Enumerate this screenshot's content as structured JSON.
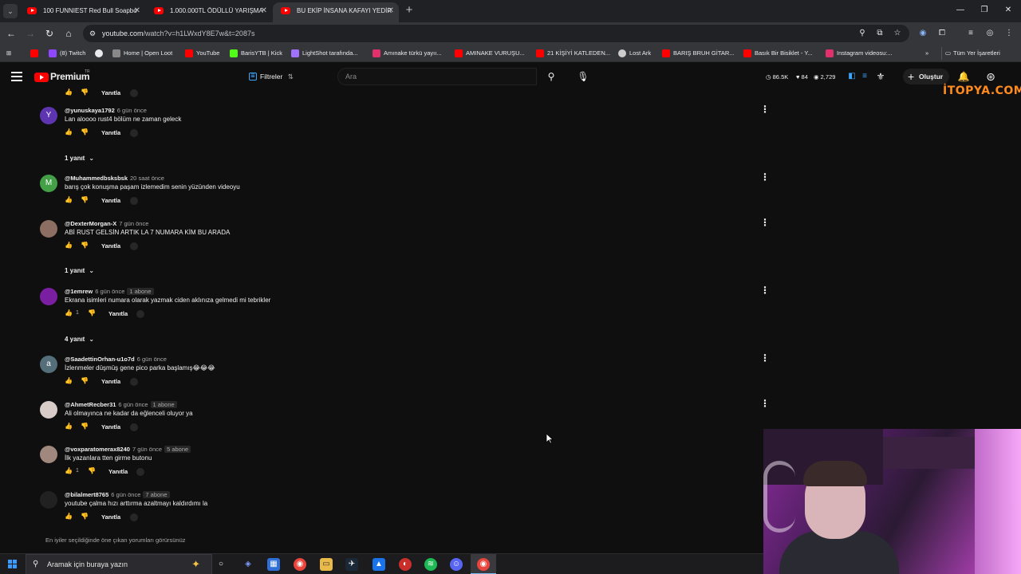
{
  "browser": {
    "tabs": [
      {
        "title": "100 FUNNIEST Red Bull Soapbo"
      },
      {
        "title": "1.000.000TL ÖDÜLLÜ YARIŞMA"
      },
      {
        "title": "BU EKİP İNSANA KAFAYI YEDİR"
      }
    ],
    "url_host": "youtube.com",
    "url_path": "/watch?v=h1LWxdY8E7w&t=2087s",
    "bookmarks": [
      {
        "label": "",
        "color": "#ff0000"
      },
      {
        "label": "(8) Twitch",
        "color": "#9146ff"
      },
      {
        "label": "",
        "color": "#e8eaed"
      },
      {
        "label": "Home | Open Loot",
        "color": "#888888"
      },
      {
        "label": "YouTube",
        "color": "#ff0000"
      },
      {
        "label": "BarisYTB | Kick",
        "color": "#53fc18"
      },
      {
        "label": "LightShot tarafında...",
        "color": "#a070ff"
      },
      {
        "label": "Amınake türkü yayıı...",
        "color": "#e1306c"
      },
      {
        "label": "AMINAKE VURUŞU...",
        "color": "#ff0000"
      },
      {
        "label": "21 KİŞİYİ KATLEDEN...",
        "color": "#ff0000"
      },
      {
        "label": "Lost Ark",
        "color": "#cccccc"
      },
      {
        "label": "BARIŞ BRUH GİTAR...",
        "color": "#ff0000"
      },
      {
        "label": "Basık Bir Bisiklet - Y...",
        "color": "#ff0000"
      },
      {
        "label": "Instagram videosu:...",
        "color": "#e1306c"
      }
    ],
    "bookmarks_overflow": "»",
    "all_bookmarks": "Tüm Yer İşaretleri"
  },
  "youtube": {
    "brand": "Premium",
    "brand_region": "TR",
    "filters_label": "Filtreler",
    "search_placeholder": "Ara",
    "stats": [
      {
        "icon": "◷",
        "value": "86.5K"
      },
      {
        "icon": "♥",
        "value": "84"
      },
      {
        "icon": "◉",
        "value": "2,729"
      }
    ],
    "create_label": "Oluştur",
    "overlay_logo": "İTOPYA.COM"
  },
  "comments": [
    {
      "author": "@yunuskaya1792",
      "time": "6 gün önce",
      "badge": "",
      "text": "Lan aloooo rust4  bölüm ne zaman geleck",
      "likes": "",
      "reply_label": "Yanıtla",
      "replies": "1 yanıt",
      "avatar_letter": "Y",
      "avatar_color": "#5e35b1"
    },
    {
      "author": "@Muhammedbsksbsk",
      "time": "20 saat önce",
      "badge": "",
      "text": "barış çok konuşma paşam izlemedim senin yüzünden videoyu",
      "likes": "",
      "reply_label": "Yanıtla",
      "replies": "",
      "avatar_letter": "M",
      "avatar_color": "#43a047"
    },
    {
      "author": "@DexterMorgan-X",
      "time": "7 gün önce",
      "badge": "",
      "text": "ABİ RUST GELSİN ARTIK LA 7 NUMARA KİM BU ARADA",
      "likes": "",
      "reply_label": "Yanıtla",
      "replies": "1 yanıt",
      "avatar_letter": "",
      "avatar_color": "#8d6e63"
    },
    {
      "author": "@1emrew",
      "time": "6 gün önce",
      "badge": "1 abone",
      "text": "Ekrana isimleri numara olarak yazmak ciden aklınıza gelmedi mi tebrikler",
      "likes": "1",
      "reply_label": "Yanıtla",
      "replies": "4 yanıt",
      "avatar_letter": "",
      "avatar_color": "#7b1fa2"
    },
    {
      "author": "@SaadettinOrhan-u1o7d",
      "time": "6 gün önce",
      "badge": "",
      "text": "İzlenmeler düşmüş gene pico parka başlamış😂😂😂",
      "likes": "",
      "reply_label": "Yanıtla",
      "replies": "",
      "avatar_letter": "a",
      "avatar_color": "#546e7a"
    },
    {
      "author": "@AhmetRecber31",
      "time": "6 gün önce",
      "badge": "1 abone",
      "text": "Ali olmayınca ne kadar da eğlenceli oluyor ya",
      "likes": "",
      "reply_label": "Yanıtla",
      "replies": "",
      "avatar_letter": "",
      "avatar_color": "#d7ccc8"
    },
    {
      "author": "@voxparatomerax8240",
      "time": "7 gün önce",
      "badge": "5 abone",
      "text": "İlk yazanlara tten girme butonu",
      "likes": "1",
      "reply_label": "Yanıtla",
      "replies": "",
      "avatar_letter": "",
      "avatar_color": "#a1887f"
    },
    {
      "author": "@bilalmert8765",
      "time": "6 gün önce",
      "badge": "7 abone",
      "text": "youtube çalma hızı arttırma azaltmayı kaldırdımı la",
      "likes": "",
      "reply_label": "Yanıtla",
      "replies": "",
      "avatar_letter": "",
      "avatar_color": "#212121"
    }
  ],
  "top_hidden_reply_label": "Yanıtla",
  "footer_note": "En iyiler seçildiğinde öne çıkan yorumları görürsünüz",
  "taskbar": {
    "search_placeholder": "Aramak için buraya yazın"
  }
}
